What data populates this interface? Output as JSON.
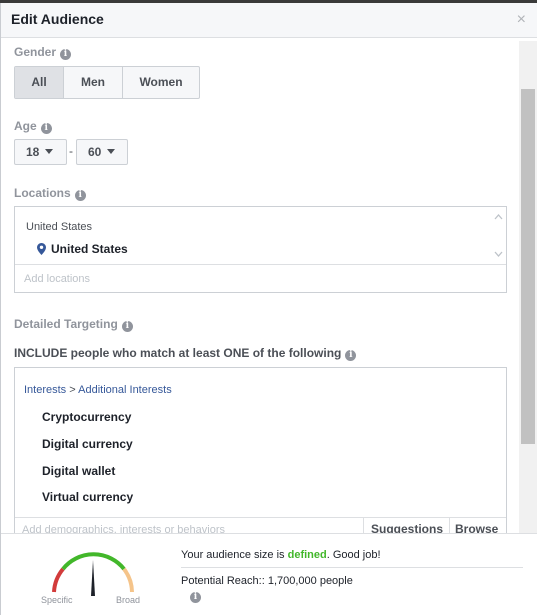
{
  "dialog": {
    "title": "Edit Audience",
    "close_glyph": "×"
  },
  "gender": {
    "label": "Gender",
    "options": [
      "All",
      "Men",
      "Women"
    ],
    "selected": "All"
  },
  "age": {
    "label": "Age",
    "min": "18",
    "separator": "-",
    "max": "60"
  },
  "locations": {
    "label": "Locations",
    "country_header": "United States",
    "selected": "United States",
    "placeholder": "Add locations"
  },
  "detailed_targeting": {
    "label": "Detailed Targeting",
    "include_text": "INCLUDE people who match at least ONE of the following",
    "breadcrumb": {
      "first": "Interests",
      "separator": ">",
      "second": "Additional Interests"
    },
    "items": [
      "Cryptocurrency",
      "Digital currency",
      "Digital wallet",
      "Virtual currency"
    ],
    "placeholder": "Add demographics, interests or behaviors",
    "suggestions_label": "Suggestions",
    "browse_label": "Browse"
  },
  "audience": {
    "status_prefix": "Your audience size is ",
    "status_value": "defined",
    "status_suffix": ". Good job!",
    "reach_text": "Potential Reach:: 1,700,000 people",
    "gauge_left_label": "Specific",
    "gauge_right_label": "Broad"
  },
  "colors": {
    "link": "#365899",
    "success": "#42b72a",
    "gauge_red": "#d23b3b",
    "gauge_green": "#42b72a",
    "gauge_orange": "#f5c48a"
  },
  "icons": [
    "info-icon",
    "close-icon",
    "location-pin-icon",
    "caret-down-icon",
    "scroll-up-icon",
    "scroll-down-icon"
  ]
}
